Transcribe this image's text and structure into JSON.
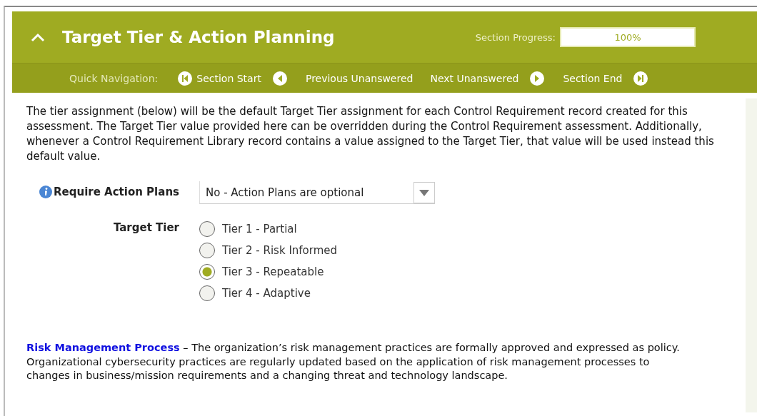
{
  "section": {
    "title": "Target Tier & Action Planning",
    "expanded": true,
    "progress_label": "Section Progress:",
    "progress_value": "100%"
  },
  "quick_navigation": {
    "label": "Quick Navigation:",
    "links": [
      {
        "label": "Section Start",
        "kind": "start"
      },
      {
        "label": "Previous Unanswered",
        "kind": "previous"
      },
      {
        "label": "Next Unanswered",
        "kind": "next"
      },
      {
        "label": "Section End",
        "kind": "end"
      }
    ]
  },
  "intro": "The tier assignment (below) will be the default Target Tier assignment for each Control Requirement record created for this assessment. The Target Tier value provided here can be overridden during the Control Requirement assessment. Additionally, whenever a Control Requirement Library record contains a value assigned to the Target Tier, that value will be used instead this default value.",
  "require_action_plans": {
    "label": "Require Action Plans",
    "value": "No - Action Plans are optional"
  },
  "target_tier": {
    "label": "Target Tier",
    "options": [
      {
        "label": "Tier 1 - Partial",
        "selected": false
      },
      {
        "label": "Tier 2 - Risk Informed",
        "selected": false
      },
      {
        "label": "Tier 3 - Repeatable",
        "selected": true
      },
      {
        "label": "Tier 4 - Adaptive",
        "selected": false
      }
    ]
  },
  "description": {
    "term": "Risk Management Process",
    "text": " – The organization’s risk management practices are formally approved and expressed as policy. Organizational cybersecurity practices are regularly updated based on the application of risk management processes to changes in business/mission requirements and a changing threat and technology landscape."
  }
}
